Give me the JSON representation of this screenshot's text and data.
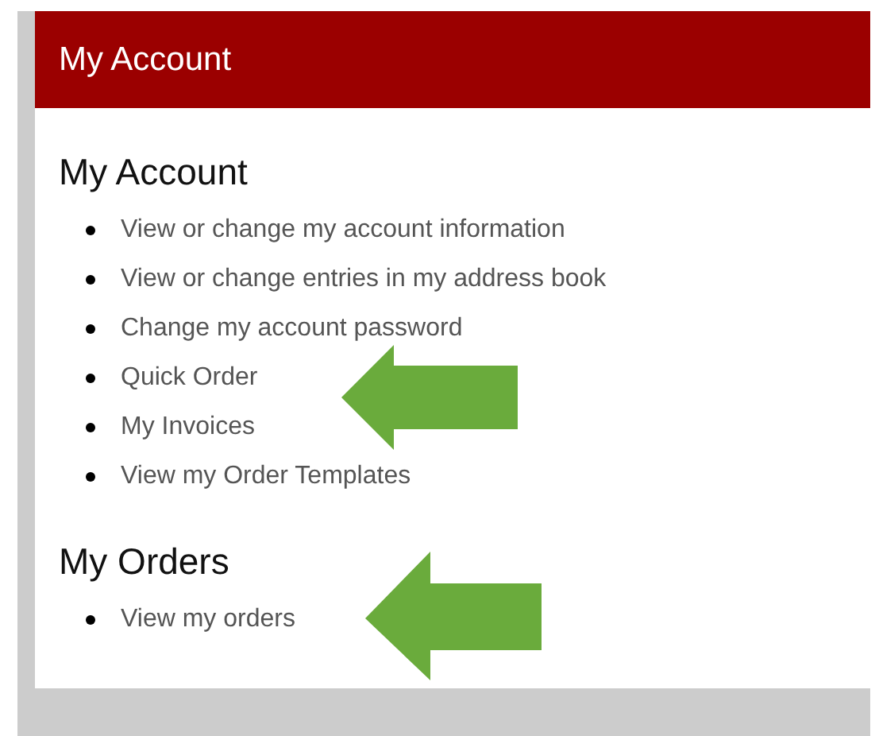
{
  "panel": {
    "title": "My Account"
  },
  "sections": [
    {
      "heading": "My Account",
      "links": [
        "View or change my account information",
        "View or change entries in my address book",
        "Change my account password",
        "Quick Order",
        "My Invoices",
        "View my Order Templates"
      ]
    },
    {
      "heading": "My Orders",
      "links": [
        "View my orders"
      ]
    }
  ]
}
